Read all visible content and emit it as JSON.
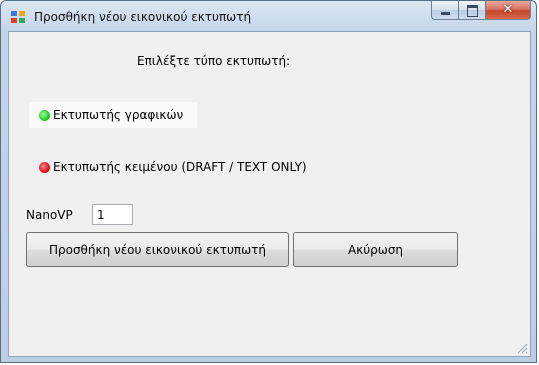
{
  "window": {
    "title": "Προσθήκη νέου εικονικού εκτυπωτή"
  },
  "dialog": {
    "prompt": "Επιλέξτε τύπο εκτυπωτή:",
    "printer_types": [
      {
        "label": "Εκτυπωτής γραφικών",
        "status_color": "#22cc22",
        "selected": true
      },
      {
        "label": "Εκτυπωτής κειμένου (DRAFT / TEXT ONLY)",
        "status_color": "#e01020",
        "selected": false
      }
    ],
    "nano_label": "NanoVP",
    "nano_value": "1",
    "add_button_label": "Προσθήκη νέου εικονικού εκτυπωτή",
    "cancel_button_label": "Ακύρωση"
  },
  "icons": {
    "app": "printer-app-icon",
    "minimize": "minimize-icon",
    "maximize": "maximize-icon",
    "close": "close-icon",
    "resize": "resize-grip-icon"
  }
}
